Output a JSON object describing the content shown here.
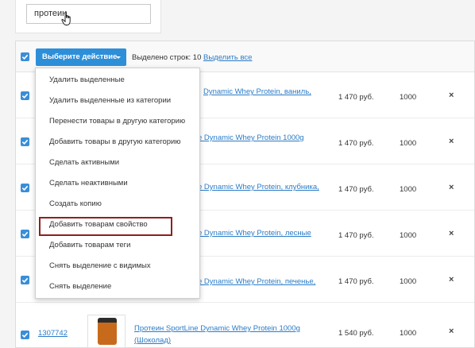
{
  "search": {
    "value": "протеин"
  },
  "toolbar": {
    "action_button": "Выберите действие",
    "selected_label": "Выделено строк:",
    "selected_count": "10",
    "select_all_link": "Выделить все"
  },
  "actions_menu": [
    "Удалить выделенные",
    "Удалить выделенные из категории",
    "Перенести товары в другую категорию",
    "Добавить товары в другую категорию",
    "Сделать активными",
    "Сделать неактивными",
    "Создать копию",
    "Добавить товарам свойство",
    "Добавить товарам теги",
    "Снять выделение с видимых",
    "Снять выделение"
  ],
  "highlighted_item": "Добавить товарам свойство",
  "rows": [
    {
      "name_fragment": "Dynamic Whey Protein, ваниль,",
      "price": "1 470 руб.",
      "qty": "1000",
      "delete": "×"
    },
    {
      "name_fragment": "e Dynamic Whey Protein 1000g",
      "price": "1 470 руб.",
      "qty": "1000",
      "delete": "×"
    },
    {
      "name_fragment": "e Dynamic Whey Protein, клубника,",
      "price": "1 470 руб.",
      "qty": "1000",
      "delete": "×"
    },
    {
      "name_fragment": "e Dynamic Whey Protein, лесные",
      "price": "1 470 руб.",
      "qty": "1000",
      "delete": "×"
    },
    {
      "name_fragment": "e Dynamic Whey Protein, печенье,",
      "price": "1 470 руб.",
      "qty": "1000",
      "delete": "×"
    },
    {
      "id": "1307742",
      "name_line1": "Протеин SportLine Dynamic Whey Protein 1000g",
      "name_line2": "(Шоколад)",
      "price": "1 540 руб.",
      "qty": "1000",
      "delete": "×"
    }
  ],
  "colors": {
    "accent": "#2e8fd9",
    "link": "#2a7cc7",
    "highlight_border": "#8f1f1f"
  }
}
